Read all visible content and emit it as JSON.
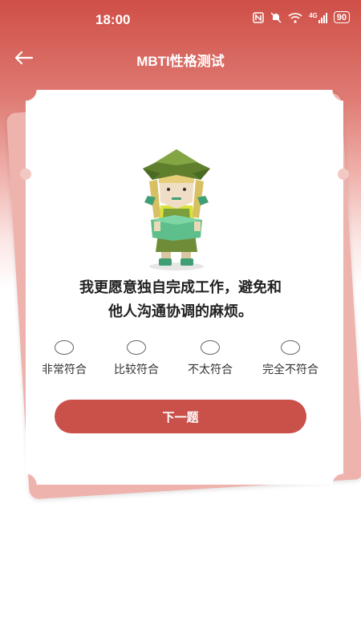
{
  "status_bar": {
    "time": "18:00",
    "signal_label": "4G",
    "battery": "90",
    "icons": [
      "nfc-icon",
      "mute-icon",
      "wifi-icon",
      "signal-icon",
      "battery-icon"
    ]
  },
  "header": {
    "title": "MBTI性格测试",
    "back_icon": "back-arrow-icon"
  },
  "question": {
    "line1": "我更愿意独自完成工作，避免和",
    "line2": "他人沟通协调的麻烦。"
  },
  "options": [
    {
      "label": "非常符合",
      "selected": false
    },
    {
      "label": "比较符合",
      "selected": false
    },
    {
      "label": "不太符合",
      "selected": false
    },
    {
      "label": "完全不符合",
      "selected": false
    }
  ],
  "next_button": {
    "label": "下一题"
  },
  "colors": {
    "accent": "#c9514a",
    "header_bg": "#cf4f47",
    "card_back": "#efb3ad"
  }
}
